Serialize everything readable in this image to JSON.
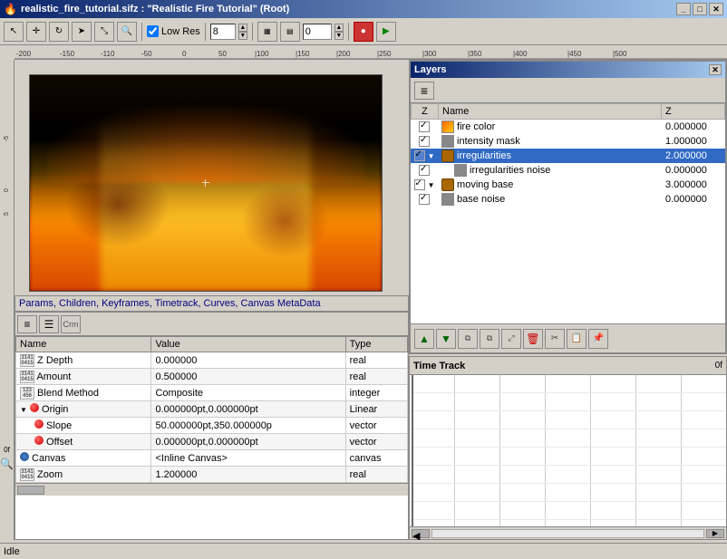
{
  "window": {
    "title": "realistic_fire_tutorial.sifz : \"Realistic Fire Tutorial\" (Root)",
    "minimize_label": "_",
    "maximize_label": "□",
    "close_label": "✕"
  },
  "toolbar": {
    "low_res_label": "Low Res",
    "quality_value": "8",
    "frame_value": "0",
    "end_frame_value": "0"
  },
  "ruler": {
    "h_labels": [
      "-200",
      "-150",
      "-110",
      "-50",
      "0",
      "50",
      "100",
      "150",
      "200",
      "250",
      "300",
      "350",
      "400",
      "450",
      "500"
    ],
    "v_labels": [
      "-5",
      "0",
      "5"
    ]
  },
  "params": {
    "tabs": "Params, Children, Keyframes, Timetrack, Curves, Canvas MetaData",
    "toolbar_icons": [
      "layer",
      "list",
      "crm"
    ],
    "columns": [
      "Name",
      "Value",
      "Type"
    ],
    "rows": [
      {
        "icon": "real",
        "name": "Z Depth",
        "value": "0.000000",
        "type": "real",
        "indent": 0
      },
      {
        "icon": "real",
        "name": "Amount",
        "value": "0.500000",
        "type": "real",
        "indent": 0
      },
      {
        "icon": "int",
        "name": "Blend Method",
        "value": "Composite",
        "type": "integer",
        "indent": 0
      },
      {
        "icon": "origin",
        "name": "Origin",
        "value": "0.000000pt,0.000000pt",
        "type": "Linear",
        "indent": 0,
        "expandable": true
      },
      {
        "icon": "red",
        "name": "Slope",
        "value": "50.000000pt,350.000000p",
        "type": "vector",
        "indent": 1
      },
      {
        "icon": "red",
        "name": "Offset",
        "value": "0.000000pt,0.000000pt",
        "type": "vector",
        "indent": 1
      },
      {
        "icon": "globe",
        "name": "Canvas",
        "value": "<Inline Canvas>",
        "type": "canvas",
        "indent": 0
      },
      {
        "icon": "real",
        "name": "Zoom",
        "value": "1.200000",
        "type": "real",
        "indent": 0
      }
    ]
  },
  "layers": {
    "title": "Layers",
    "columns": [
      "Z",
      "Name",
      "Z"
    ],
    "rows": [
      {
        "checked": true,
        "indent": 0,
        "has_arrow": false,
        "type": "color",
        "name": "fire color",
        "z": "0.000000"
      },
      {
        "checked": true,
        "indent": 0,
        "has_arrow": false,
        "type": "mask",
        "name": "intensity mask",
        "z": "1.000000"
      },
      {
        "checked": true,
        "indent": 0,
        "has_arrow": true,
        "type": "group",
        "name": "irregularities",
        "z": "2.000000",
        "selected": true
      },
      {
        "checked": true,
        "indent": 1,
        "has_arrow": false,
        "type": "noise",
        "name": "irregularities noise",
        "z": "0.000000"
      },
      {
        "checked": true,
        "indent": 0,
        "has_arrow": true,
        "type": "group",
        "name": "moving base",
        "z": "3.000000"
      },
      {
        "checked": true,
        "indent": 0,
        "has_arrow": false,
        "type": "noise",
        "name": "base noise",
        "z": "0.000000"
      }
    ],
    "footer_buttons": [
      "↑",
      "↓",
      "dup",
      "dup2",
      "resize",
      "delete",
      "cut",
      "copy",
      "paste"
    ]
  },
  "timetrack": {
    "title": "Time Track",
    "frame_label": "0f",
    "row_labels": [
      "",
      "",
      "",
      "",
      "",
      "",
      ""
    ]
  },
  "status": {
    "text": "Idle"
  },
  "sidebar": {
    "frame_label": "0f"
  }
}
